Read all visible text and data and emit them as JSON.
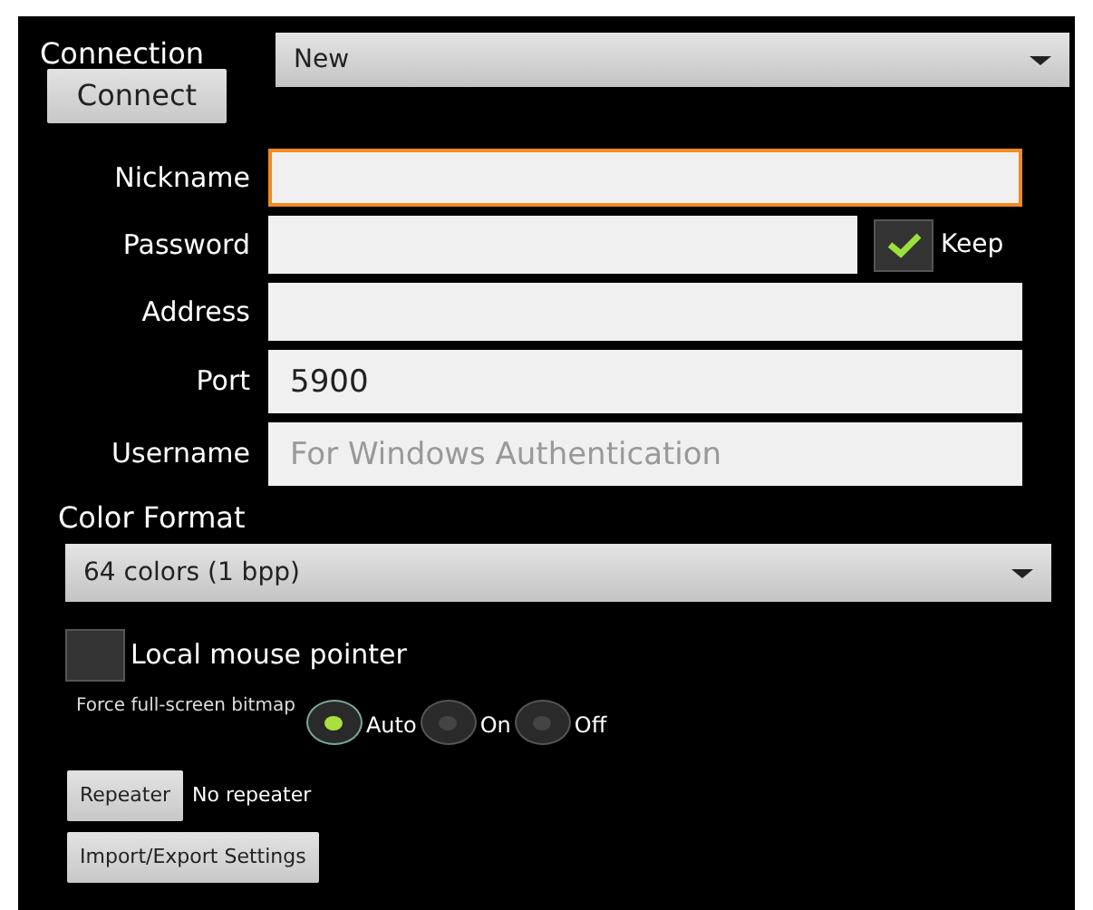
{
  "connection": {
    "label": "Connection",
    "value": "New",
    "connect_button": "Connect"
  },
  "fields": [
    {
      "label": "Nickname",
      "focused": true
    },
    {
      "label": "Password",
      "focused": false,
      "keep": {
        "label": "Keep",
        "checked": true
      }
    },
    {
      "label": "Address",
      "focused": false
    },
    {
      "label": "Port",
      "value": "5900",
      "focused": false
    },
    {
      "label": "Username",
      "placeholder": "For Windows Authentication",
      "focused": false
    }
  ],
  "color_format": {
    "label": "Color Format",
    "value": "64 colors (1 bpp)"
  },
  "local_mouse": {
    "label": "Local mouse pointer",
    "checked": false
  },
  "fullscreen": {
    "label": "Force full-screen bitmap",
    "options": [
      {
        "label": "Auto",
        "selected": true
      },
      {
        "label": "On",
        "selected": false
      },
      {
        "label": "Off",
        "selected": false
      }
    ]
  },
  "repeater": {
    "button": "Repeater",
    "status": "No repeater"
  },
  "import_export": "Import/Export Settings"
}
